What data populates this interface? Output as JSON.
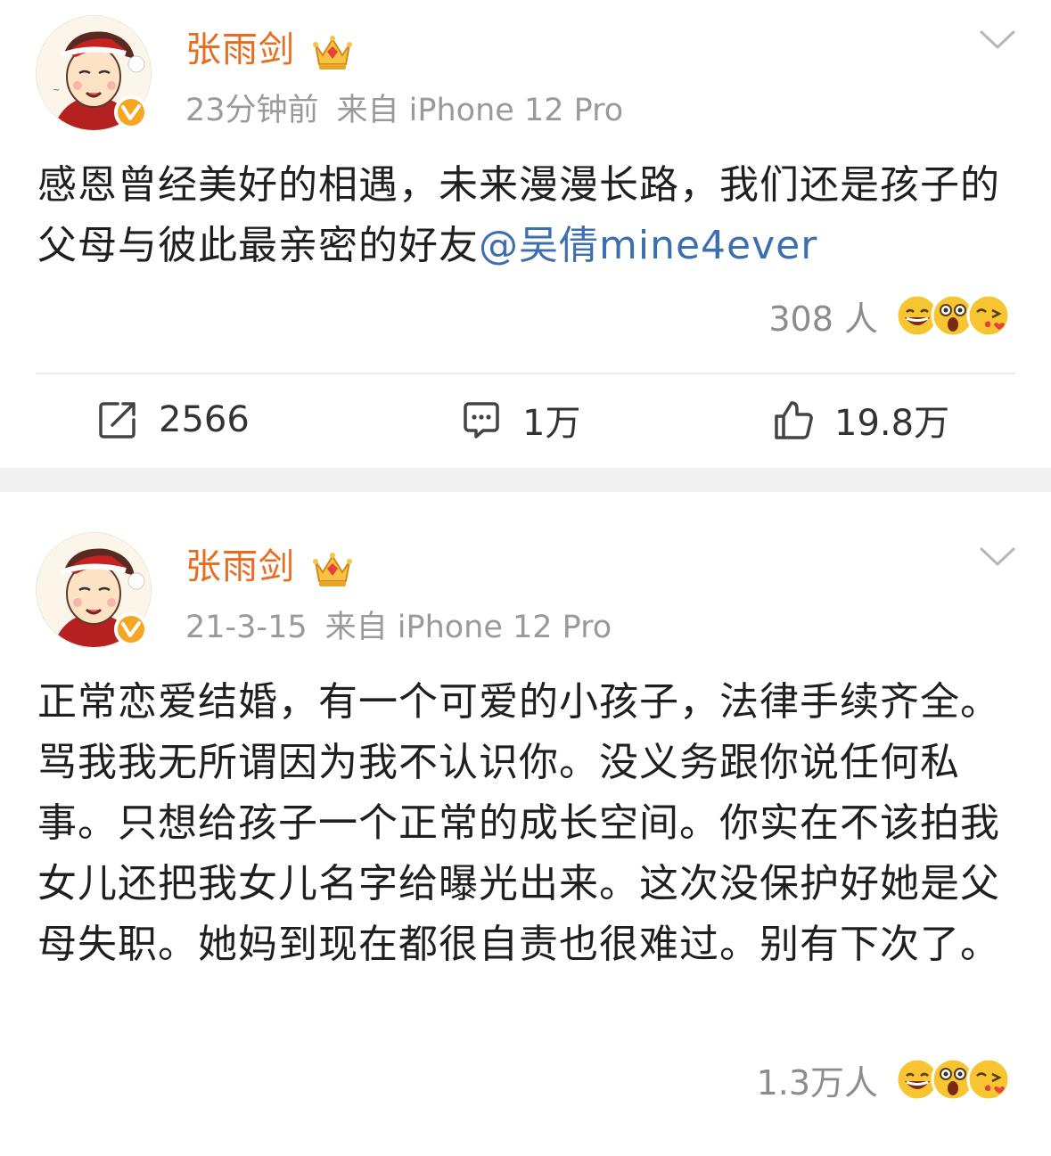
{
  "posts": [
    {
      "username": "张雨剑",
      "time": "23分钟前",
      "source": "来自 iPhone 12 Pro",
      "content_text": "感恩曾经美好的相遇，未来漫漫长路，我们还是孩子的父母与彼此最亲密的好友",
      "mention": "@吴倩mine4ever",
      "reaction_count": "308 人",
      "actions": {
        "repost_count": "2566",
        "comment_count": "1万",
        "like_count": "19.8万"
      }
    },
    {
      "username": "张雨剑",
      "time": "21-3-15",
      "source": "来自 iPhone 12 Pro",
      "content_text": "正常恋爱结婚，有一个可爱的小孩子，法律手续齐全。骂我我无所谓因为我不认识你。没义务跟你说任何私事。只想给孩子一个正常的成长空间。你实在不该拍我女儿还把我女儿名字给曝光出来。这次没保护好她是父母失职。她妈到现在都很自责也很难过。别有下次了。",
      "reaction_count": "1.3万人"
    }
  ],
  "colors": {
    "username": "#e86b1e",
    "mention": "#3b6fb0",
    "meta": "#9a9a9a",
    "verified_badge": "#f5a623",
    "separator": "#f1f1f1"
  },
  "icons": {
    "avatar": "cartoon-avatar-santa-hat",
    "verified": "verified-v-badge",
    "crown": "crown-member-icon",
    "more": "chevron-down-icon",
    "reactions": [
      "laughing-emoji",
      "surprised-emoji",
      "kiss-emoji"
    ],
    "repost": "repost-icon",
    "comment": "comment-icon",
    "like": "thumbs-up-icon"
  }
}
